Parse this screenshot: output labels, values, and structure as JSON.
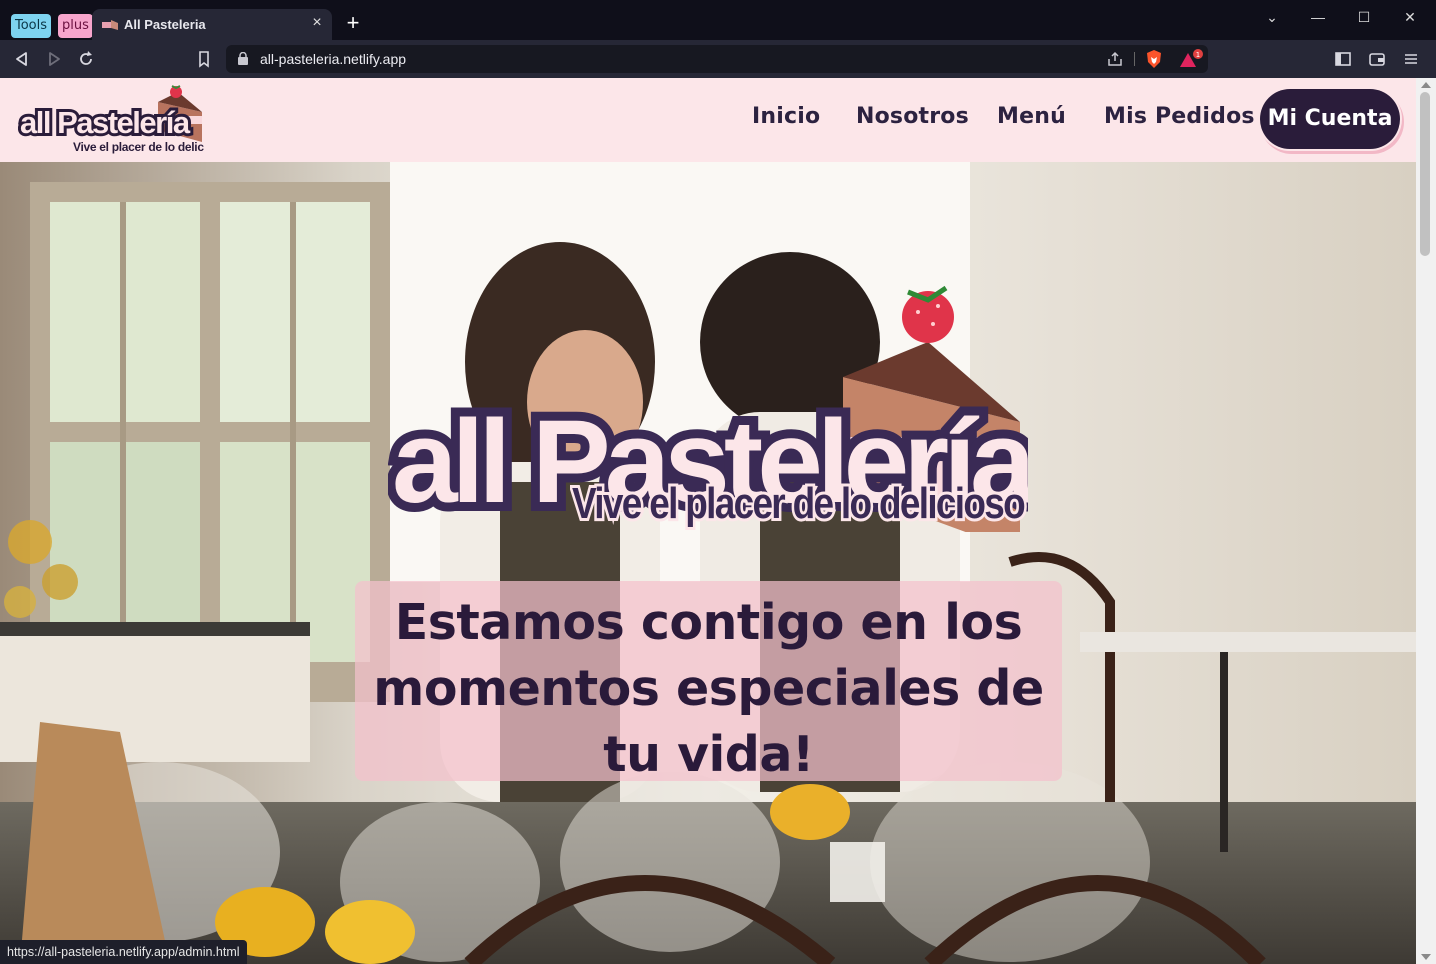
{
  "browser": {
    "tab_groups": [
      "Tools",
      "plus"
    ],
    "tab": {
      "title": "All Pasteleria",
      "close": "×"
    },
    "new_tab": "+",
    "window_controls": [
      "⌄",
      "—",
      "☐",
      "✕"
    ],
    "url": "all-pasteleria.netlify.app",
    "rewards_badge": "1",
    "status_url": "https://all-pasteleria.netlify.app/admin.html",
    "icons": [
      "back-icon",
      "forward-icon",
      "reload-icon",
      "bookmark-icon",
      "lock-icon",
      "share-icon",
      "brave-shield-icon",
      "brave-rewards-icon",
      "sidebar-icon",
      "wallet-icon",
      "menu-icon"
    ]
  },
  "site": {
    "logo": {
      "brand": "all Pastelería",
      "tagline": "Vive el placer de lo delicioso"
    },
    "nav": [
      {
        "label": "Inicio"
      },
      {
        "label": "Nosotros"
      },
      {
        "label": "Menú"
      },
      {
        "label": "Mis Pedidos"
      }
    ],
    "account_button": "Mi Cuenta",
    "hero": {
      "logo_brand": "all Pastelería",
      "logo_tagline": "Vive el placer de lo delicioso",
      "heading": "Estamos contigo en los momentos especiales de tu vida!"
    }
  },
  "colors": {
    "header_bg": "#fce6e9",
    "brand_dark": "#2a1c3a",
    "hero_box": "#f4c0cc",
    "accent_pink": "#f05a7e"
  }
}
